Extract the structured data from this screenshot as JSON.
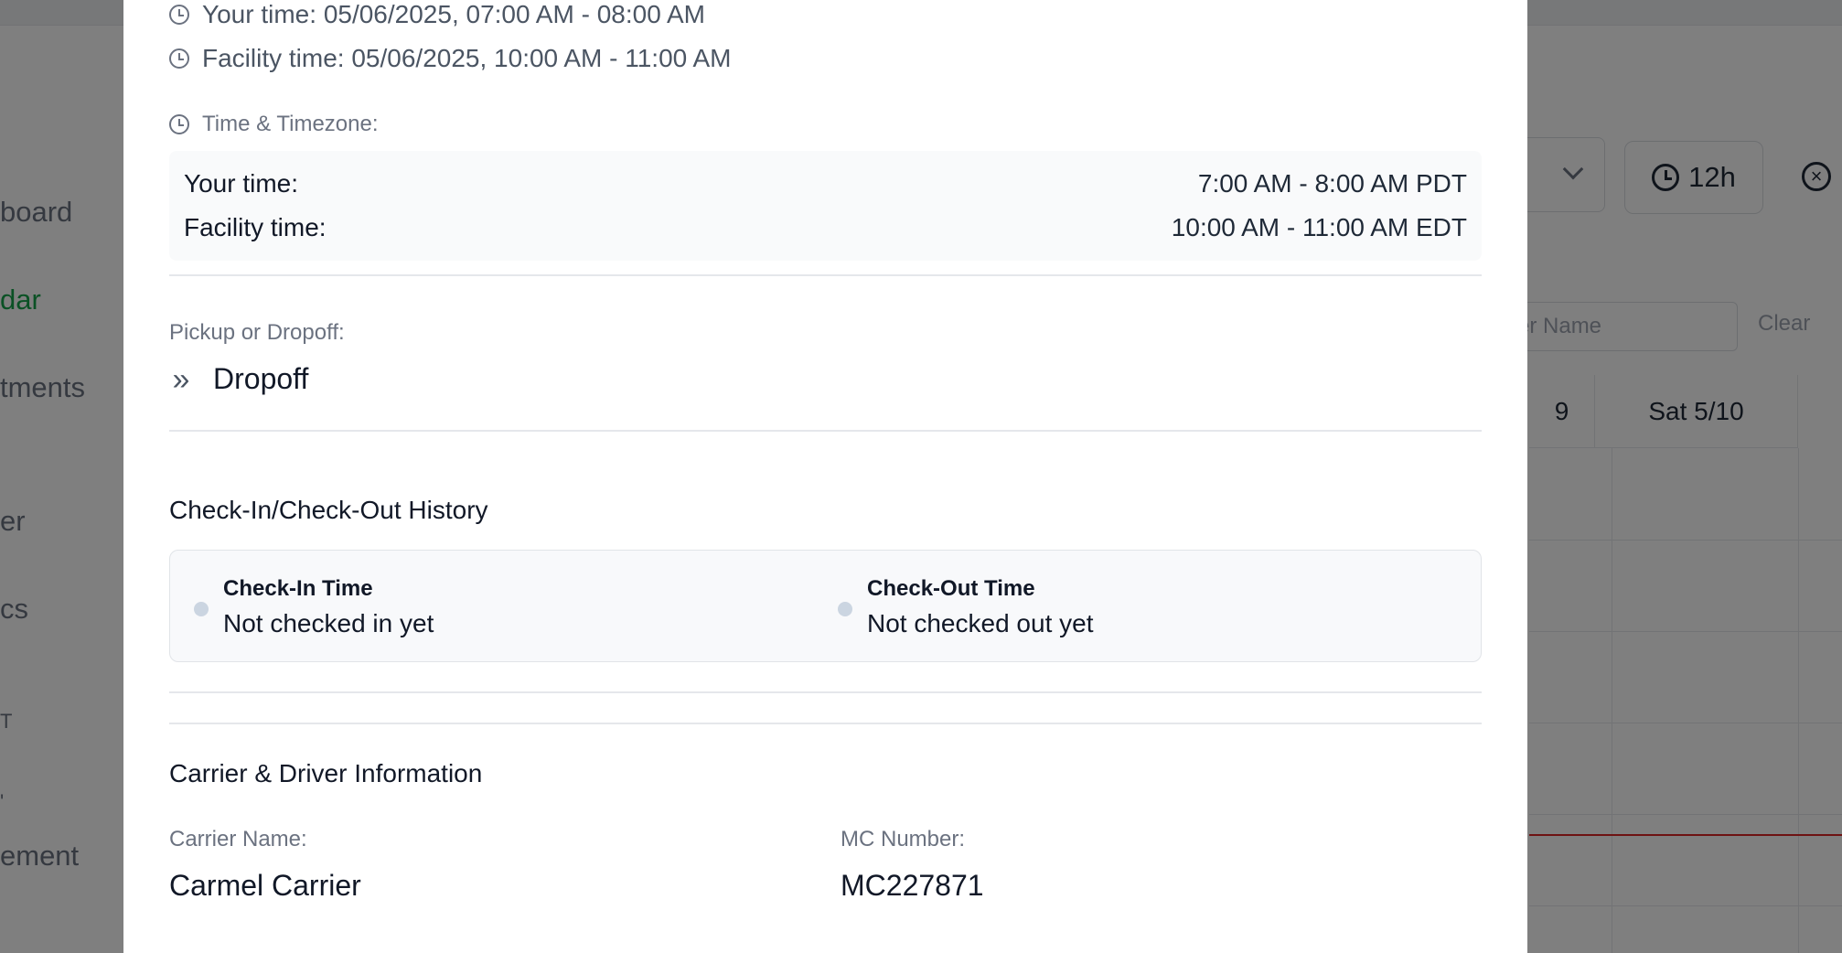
{
  "background": {
    "nav_items": [
      "board",
      "dar",
      "tments",
      "er",
      "cs",
      "T",
      "'",
      "ement"
    ],
    "active_nav_index": 1,
    "hour_format_label": "12h",
    "close_symbol": "×",
    "search_placeholder": "er Name",
    "clear_label": "Clear",
    "day_headers": [
      "9",
      "Sat 5/10"
    ]
  },
  "appointment": {
    "your_time_label": "Your time:",
    "your_time_value": "05/06/2025, 07:00 AM - 08:00 AM",
    "facility_time_label": "Facility time:",
    "facility_time_value": "05/06/2025, 10:00 AM - 11:00 AM",
    "timezone": {
      "label": "Time & Timezone:",
      "your_time_label": "Your time:",
      "your_time_value": "7:00 AM - 8:00 AM PDT",
      "facility_time_label": "Facility time:",
      "facility_time_value": "10:00 AM - 11:00 AM EDT"
    },
    "pickup_dropoff": {
      "label": "Pickup or Dropoff:",
      "value": "Dropoff",
      "icon": "chevrons-right-icon"
    }
  },
  "history": {
    "title": "Check-In/Check-Out History",
    "check_in_label": "Check-In Time",
    "check_in_value": "Not checked in yet",
    "check_out_label": "Check-Out Time",
    "check_out_value": "Not checked out yet"
  },
  "carrier": {
    "title": "Carrier & Driver Information",
    "carrier_name_label": "Carrier Name:",
    "carrier_name_value": "Carmel Carrier",
    "mc_number_label": "MC Number:",
    "mc_number_value": "MC227871"
  }
}
